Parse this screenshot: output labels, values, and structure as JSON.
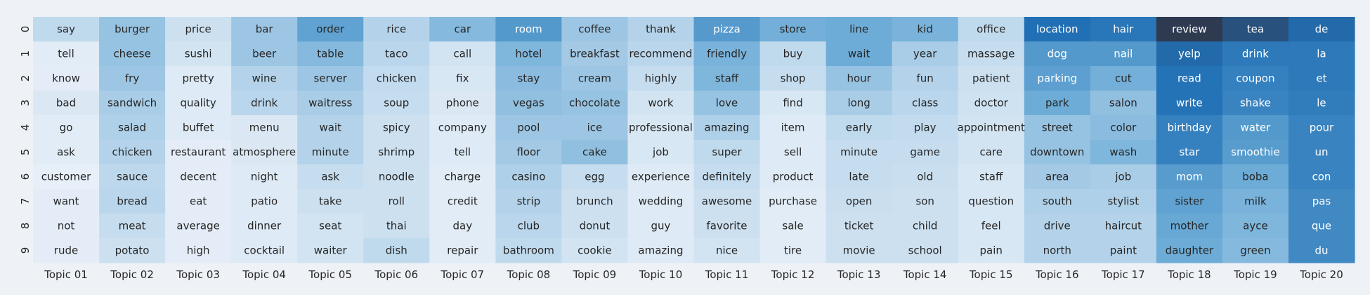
{
  "chart_data": {
    "type": "heatmap",
    "title": "",
    "xlabel": "",
    "ylabel": "",
    "row_labels": [
      "0",
      "1",
      "2",
      "3",
      "4",
      "5",
      "6",
      "7",
      "8",
      "9"
    ],
    "columns": [
      {
        "label": "Topic 01",
        "words": [
          "say",
          "tell",
          "know",
          "bad",
          "go",
          "ask",
          "customer",
          "want",
          "not",
          "rude"
        ],
        "values": [
          0.16,
          0.05,
          0.04,
          0.07,
          0.05,
          0.05,
          0.03,
          0.04,
          0.04,
          0.04
        ]
      },
      {
        "label": "Topic 02",
        "words": [
          "burger",
          "cheese",
          "fry",
          "sandwich",
          "salad",
          "chicken",
          "sauce",
          "bread",
          "meat",
          "potato"
        ],
        "values": [
          0.3,
          0.3,
          0.28,
          0.24,
          0.22,
          0.2,
          0.17,
          0.18,
          0.14,
          0.12
        ]
      },
      {
        "label": "Topic 03",
        "words": [
          "price",
          "sushi",
          "pretty",
          "quality",
          "buffet",
          "restaurant",
          "decent",
          "eat",
          "average",
          "high"
        ],
        "values": [
          0.12,
          0.1,
          0.06,
          0.06,
          0.06,
          0.04,
          0.04,
          0.04,
          0.04,
          0.04
        ]
      },
      {
        "label": "Topic 04",
        "words": [
          "bar",
          "beer",
          "wine",
          "drink",
          "menu",
          "atmosphere",
          "night",
          "patio",
          "dinner",
          "cocktail"
        ],
        "values": [
          0.28,
          0.28,
          0.2,
          0.18,
          0.07,
          0.07,
          0.06,
          0.06,
          0.06,
          0.06
        ]
      },
      {
        "label": "Topic 05",
        "words": [
          "order",
          "table",
          "server",
          "waitress",
          "wait",
          "minute",
          "ask",
          "take",
          "seat",
          "waiter"
        ],
        "values": [
          0.5,
          0.36,
          0.28,
          0.24,
          0.2,
          0.2,
          0.14,
          0.12,
          0.1,
          0.1
        ]
      },
      {
        "label": "Topic 06",
        "words": [
          "rice",
          "taco",
          "chicken",
          "soup",
          "spicy",
          "shrimp",
          "noodle",
          "roll",
          "thai",
          "dish"
        ],
        "values": [
          0.2,
          0.18,
          0.15,
          0.14,
          0.12,
          0.12,
          0.12,
          0.12,
          0.12,
          0.16
        ]
      },
      {
        "label": "Topic 07",
        "words": [
          "car",
          "call",
          "fix",
          "phone",
          "company",
          "tell",
          "charge",
          "credit",
          "day",
          "repair"
        ],
        "values": [
          0.36,
          0.1,
          0.08,
          0.07,
          0.06,
          0.06,
          0.05,
          0.05,
          0.05,
          0.05
        ]
      },
      {
        "label": "Topic 08",
        "words": [
          "room",
          "hotel",
          "stay",
          "vegas",
          "pool",
          "floor",
          "casino",
          "strip",
          "club",
          "bathroom"
        ],
        "values": [
          0.56,
          0.38,
          0.34,
          0.32,
          0.28,
          0.26,
          0.22,
          0.2,
          0.18,
          0.16
        ]
      },
      {
        "label": "Topic 09",
        "words": [
          "coffee",
          "breakfast",
          "cream",
          "chocolate",
          "ice",
          "cake",
          "egg",
          "brunch",
          "donut",
          "cookie"
        ],
        "values": [
          0.28,
          0.26,
          0.28,
          0.3,
          0.28,
          0.32,
          0.14,
          0.12,
          0.12,
          0.1
        ]
      },
      {
        "label": "Topic 10",
        "words": [
          "thank",
          "recommend",
          "highly",
          "work",
          "professional",
          "job",
          "experience",
          "wedding",
          "guy",
          "amazing"
        ],
        "values": [
          0.2,
          0.18,
          0.14,
          0.1,
          0.08,
          0.08,
          0.06,
          0.06,
          0.06,
          0.06
        ]
      },
      {
        "label": "Topic 11",
        "words": [
          "pizza",
          "friendly",
          "staff",
          "love",
          "amazing",
          "super",
          "definitely",
          "awesome",
          "favorite",
          "nice"
        ],
        "values": [
          0.55,
          0.4,
          0.38,
          0.3,
          0.22,
          0.16,
          0.14,
          0.12,
          0.12,
          0.1
        ]
      },
      {
        "label": "Topic 12",
        "words": [
          "store",
          "buy",
          "shop",
          "find",
          "item",
          "sell",
          "product",
          "purchase",
          "sale",
          "tire"
        ],
        "values": [
          0.42,
          0.16,
          0.14,
          0.08,
          0.06,
          0.06,
          0.06,
          0.05,
          0.05,
          0.05
        ]
      },
      {
        "label": "Topic 13",
        "words": [
          "line",
          "wait",
          "hour",
          "long",
          "early",
          "minute",
          "late",
          "open",
          "ticket",
          "movie"
        ],
        "values": [
          0.44,
          0.44,
          0.3,
          0.24,
          0.16,
          0.14,
          0.14,
          0.13,
          0.12,
          0.12
        ]
      },
      {
        "label": "Topic 14",
        "words": [
          "kid",
          "year",
          "fun",
          "class",
          "play",
          "game",
          "old",
          "son",
          "child",
          "school"
        ],
        "values": [
          0.4,
          0.24,
          0.2,
          0.18,
          0.15,
          0.14,
          0.13,
          0.12,
          0.12,
          0.12
        ]
      },
      {
        "label": "Topic 15",
        "words": [
          "office",
          "massage",
          "patient",
          "doctor",
          "appointment",
          "care",
          "staff",
          "question",
          "feel",
          "pain"
        ],
        "values": [
          0.16,
          0.14,
          0.12,
          0.11,
          0.1,
          0.1,
          0.08,
          0.08,
          0.08,
          0.08
        ]
      },
      {
        "label": "Topic 16",
        "words": [
          "location",
          "dog",
          "parking",
          "park",
          "street",
          "downtown",
          "area",
          "south",
          "drive",
          "north"
        ],
        "values": [
          0.82,
          0.56,
          0.52,
          0.44,
          0.3,
          0.3,
          0.26,
          0.22,
          0.2,
          0.2
        ]
      },
      {
        "label": "Topic 17",
        "words": [
          "hair",
          "nail",
          "cut",
          "salon",
          "color",
          "wash",
          "job",
          "stylist",
          "haircut",
          "paint"
        ],
        "values": [
          0.78,
          0.56,
          0.42,
          0.32,
          0.34,
          0.38,
          0.24,
          0.22,
          0.2,
          0.2
        ]
      },
      {
        "label": "Topic 18",
        "words": [
          "review",
          "yelp",
          "read",
          "write",
          "birthday",
          "star",
          "mom",
          "sister",
          "mother",
          "daughter"
        ],
        "values": [
          1.0,
          0.84,
          0.8,
          0.8,
          0.72,
          0.72,
          0.54,
          0.5,
          0.46,
          0.44
        ]
      },
      {
        "label": "Topic 19",
        "words": [
          "tea",
          "drink",
          "coupon",
          "shake",
          "water",
          "smoothie",
          "boba",
          "milk",
          "ayce",
          "green"
        ],
        "values": [
          0.92,
          0.76,
          0.72,
          0.7,
          0.56,
          0.54,
          0.44,
          0.4,
          0.38,
          0.36
        ]
      },
      {
        "label": "Topic 20",
        "words": [
          "de",
          "la",
          "et",
          "le",
          "pour",
          "un",
          "con",
          "pas",
          "que",
          "du"
        ],
        "values": [
          0.84,
          0.76,
          0.76,
          0.74,
          0.7,
          0.7,
          0.7,
          0.66,
          0.66,
          0.66
        ]
      }
    ],
    "color_scale": {
      "low": "#f0f4fa",
      "mid": "#6aaad6",
      "high_mid": "#2170b5",
      "max": "#2e3a50"
    },
    "grid": false,
    "legend": "none"
  }
}
